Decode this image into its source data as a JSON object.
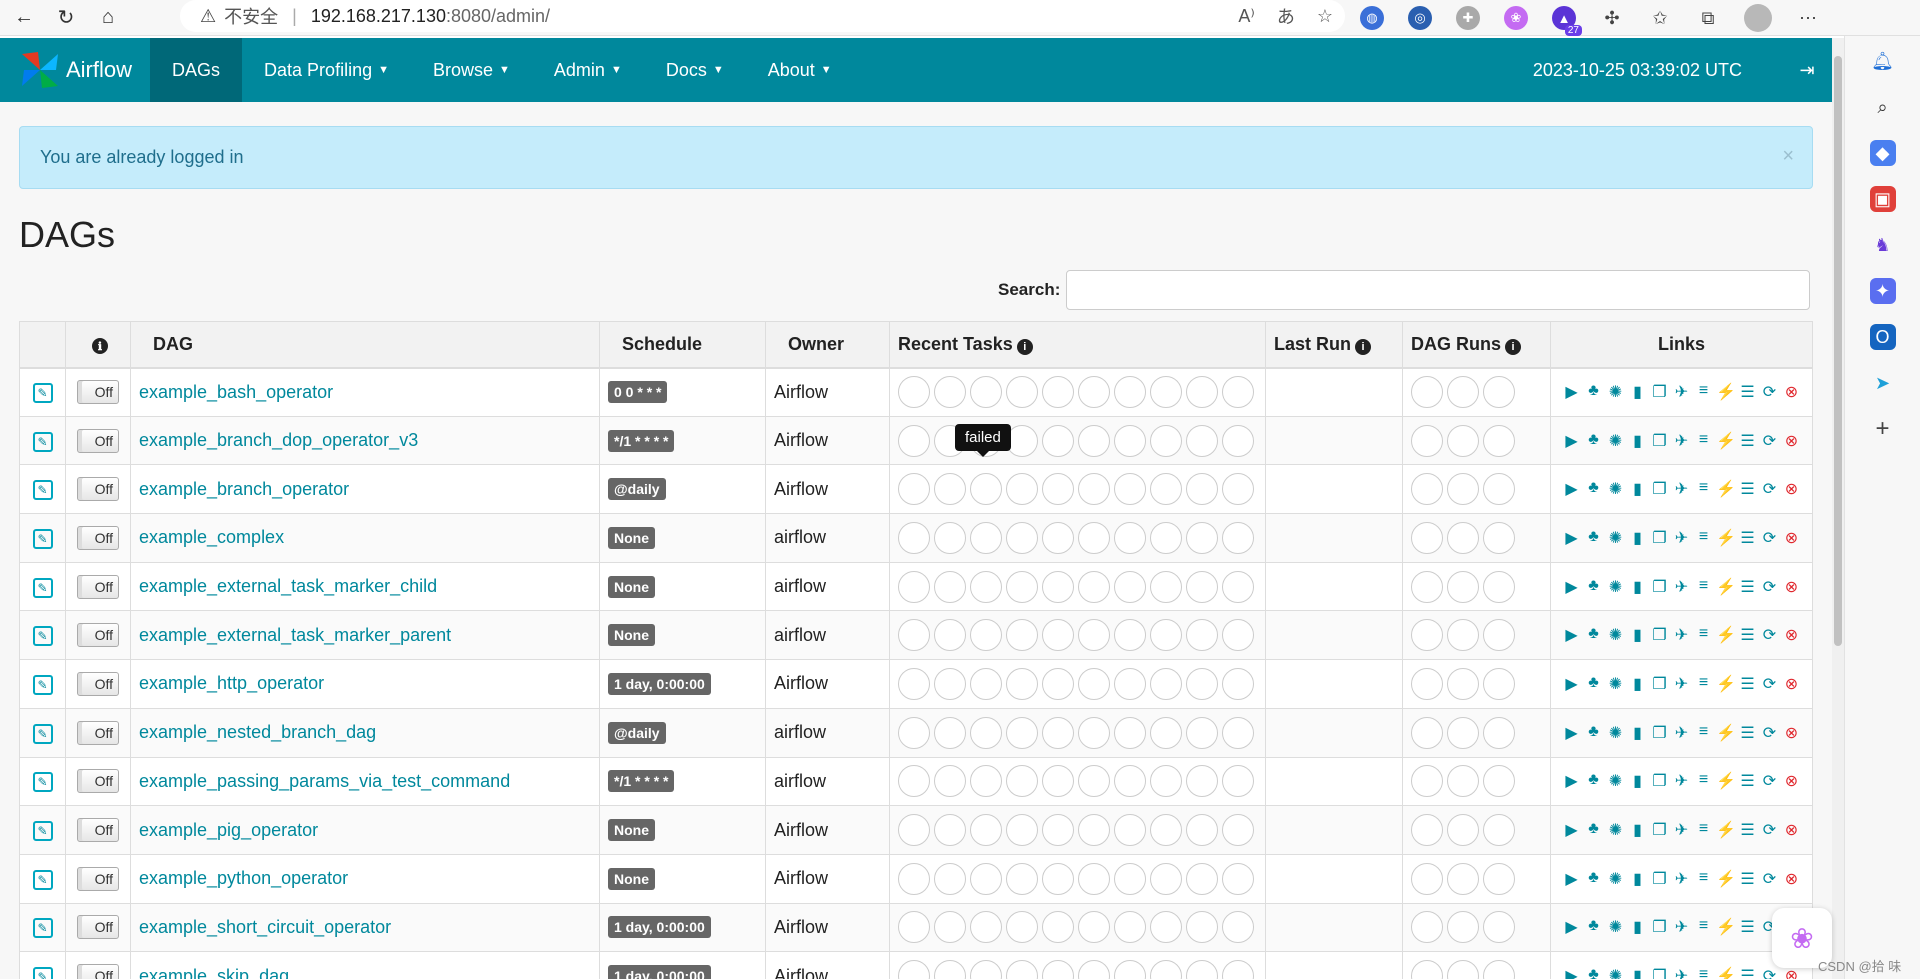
{
  "browser": {
    "insecure_label": "不安全",
    "url_host": "192.168.217.130",
    "url_path": ":8080/admin/",
    "ext_badge": "27"
  },
  "nav": {
    "brand": "Airflow",
    "items": [
      {
        "label": "DAGs",
        "caret": false
      },
      {
        "label": "Data Profiling",
        "caret": true
      },
      {
        "label": "Browse",
        "caret": true
      },
      {
        "label": "Admin",
        "caret": true
      },
      {
        "label": "Docs",
        "caret": true
      },
      {
        "label": "About",
        "caret": true
      }
    ],
    "clock": "2023-10-25 03:39:02 UTC"
  },
  "alert": {
    "message": "You are already logged in",
    "close": "×"
  },
  "page": {
    "title": "DAGs"
  },
  "search": {
    "label": "Search:",
    "value": ""
  },
  "table": {
    "headers": {
      "info": "ℹ",
      "dag": "DAG",
      "schedule": "Schedule",
      "owner": "Owner",
      "recent_tasks": "Recent Tasks",
      "last_run": "Last Run",
      "dag_runs": "DAG Runs",
      "links": "Links"
    },
    "toggle_label": "Off",
    "rows": [
      {
        "dag": "example_bash_operator",
        "schedule": "0 0 * * *",
        "owner": "Airflow"
      },
      {
        "dag": "example_branch_dop_operator_v3",
        "schedule": "*/1 * * * *",
        "owner": "Airflow"
      },
      {
        "dag": "example_branch_operator",
        "schedule": "@daily",
        "owner": "Airflow"
      },
      {
        "dag": "example_complex",
        "schedule": "None",
        "owner": "airflow"
      },
      {
        "dag": "example_external_task_marker_child",
        "schedule": "None",
        "owner": "airflow"
      },
      {
        "dag": "example_external_task_marker_parent",
        "schedule": "None",
        "owner": "airflow"
      },
      {
        "dag": "example_http_operator",
        "schedule": "1 day, 0:00:00",
        "owner": "Airflow"
      },
      {
        "dag": "example_nested_branch_dag",
        "schedule": "@daily",
        "owner": "airflow"
      },
      {
        "dag": "example_passing_params_via_test_command",
        "schedule": "*/1 * * * *",
        "owner": "airflow"
      },
      {
        "dag": "example_pig_operator",
        "schedule": "None",
        "owner": "Airflow"
      },
      {
        "dag": "example_python_operator",
        "schedule": "None",
        "owner": "Airflow"
      },
      {
        "dag": "example_short_circuit_operator",
        "schedule": "1 day, 0:00:00",
        "owner": "Airflow"
      },
      {
        "dag": "example_skip_dag",
        "schedule": "1 day, 0:00:00",
        "owner": "Airflow"
      }
    ]
  },
  "tooltip": {
    "text": "failed"
  },
  "watermark": "CSDN @拾 味",
  "colors": {
    "navbar": "#00889c",
    "link": "#00889c",
    "alert_bg": "#c5ecfb",
    "delete": "#e0282e"
  }
}
